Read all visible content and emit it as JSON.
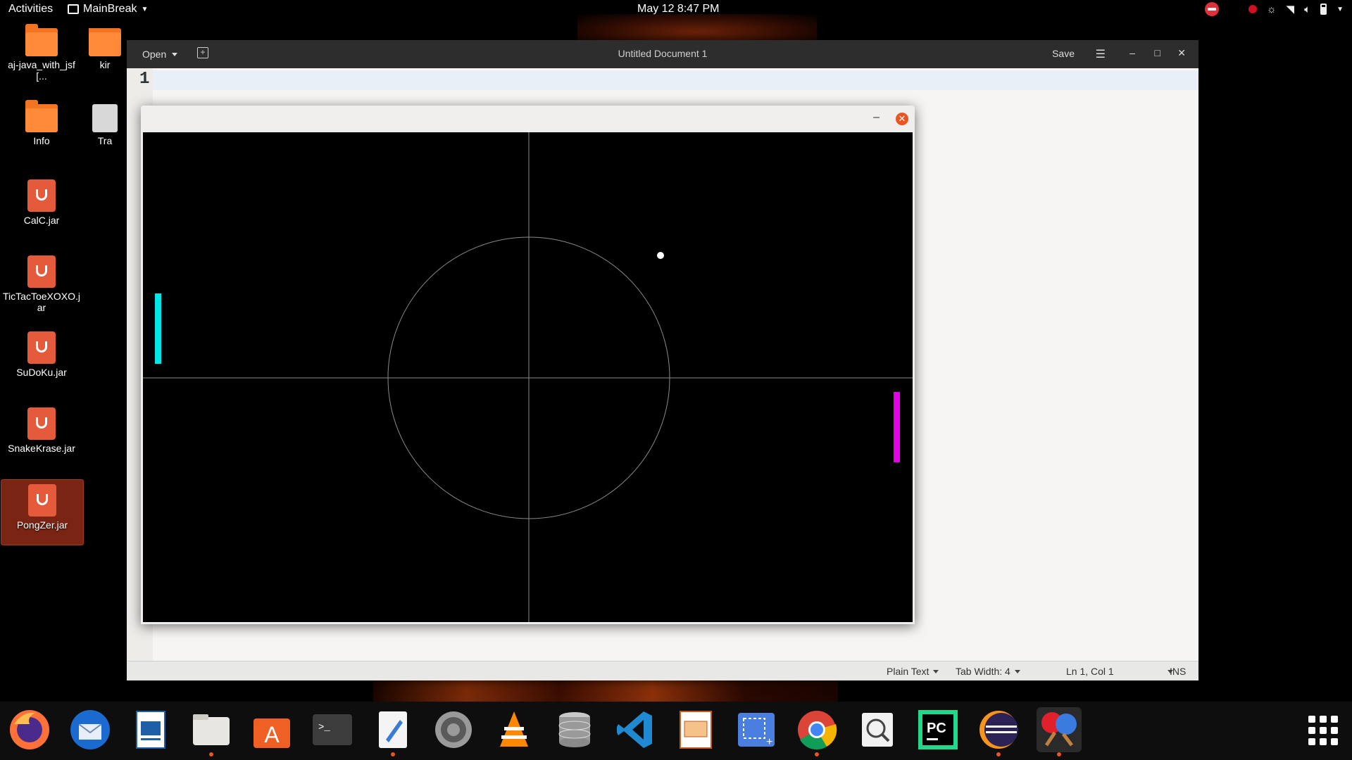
{
  "topbar": {
    "activities": "Activities",
    "app_menu": "MainBreak",
    "clock": "May 12  8:47 PM"
  },
  "desktop": {
    "icons": [
      {
        "label": "aj-java_with_jsf[...",
        "type": "folder"
      },
      {
        "label": "kir",
        "type": "folder"
      },
      {
        "label": "Info",
        "type": "folder"
      },
      {
        "label": "Tra",
        "type": "trash"
      },
      {
        "label": "CalC.jar",
        "type": "jar"
      },
      {
        "label": "TicTacToeXOXO.jar",
        "type": "jar"
      },
      {
        "label": "SuDoKu.jar",
        "type": "jar"
      },
      {
        "label": "SnakeKrase.jar",
        "type": "jar"
      },
      {
        "label": "PongZer.jar",
        "type": "jar",
        "selected": true
      }
    ]
  },
  "gedit": {
    "open_label": "Open",
    "title": "Untitled Document 1",
    "save_label": "Save",
    "line_number": "1",
    "status": {
      "language": "Plain Text",
      "tab_width": "Tab Width: 4",
      "position": "Ln 1, Col 1",
      "mode": "INS"
    }
  },
  "pong": {
    "colors": {
      "left_paddle": "#00e5e5",
      "right_paddle": "#e600e6",
      "ball": "#ffffff",
      "field_lines": "#8a8a8a",
      "background": "#000000"
    }
  },
  "dock": {
    "apps": [
      {
        "name": "firefox-icon",
        "running": false
      },
      {
        "name": "thunderbird-icon",
        "running": false
      },
      {
        "name": "libreoffice-writer-icon",
        "running": false
      },
      {
        "name": "files-icon",
        "running": true
      },
      {
        "name": "software-center-icon",
        "running": false
      },
      {
        "name": "terminal-icon",
        "running": false
      },
      {
        "name": "text-editor-icon",
        "running": true
      },
      {
        "name": "settings-icon",
        "running": false
      },
      {
        "name": "vlc-icon",
        "running": false
      },
      {
        "name": "database-icon",
        "running": false
      },
      {
        "name": "vscode-icon",
        "running": false
      },
      {
        "name": "impress-icon",
        "running": false
      },
      {
        "name": "screenshot-icon",
        "running": false
      },
      {
        "name": "chrome-icon",
        "running": true
      },
      {
        "name": "image-viewer-icon",
        "running": false
      },
      {
        "name": "pycharm-icon",
        "running": false
      },
      {
        "name": "eclipse-icon",
        "running": true
      },
      {
        "name": "pong-game-icon",
        "running": true,
        "active": true
      }
    ]
  }
}
